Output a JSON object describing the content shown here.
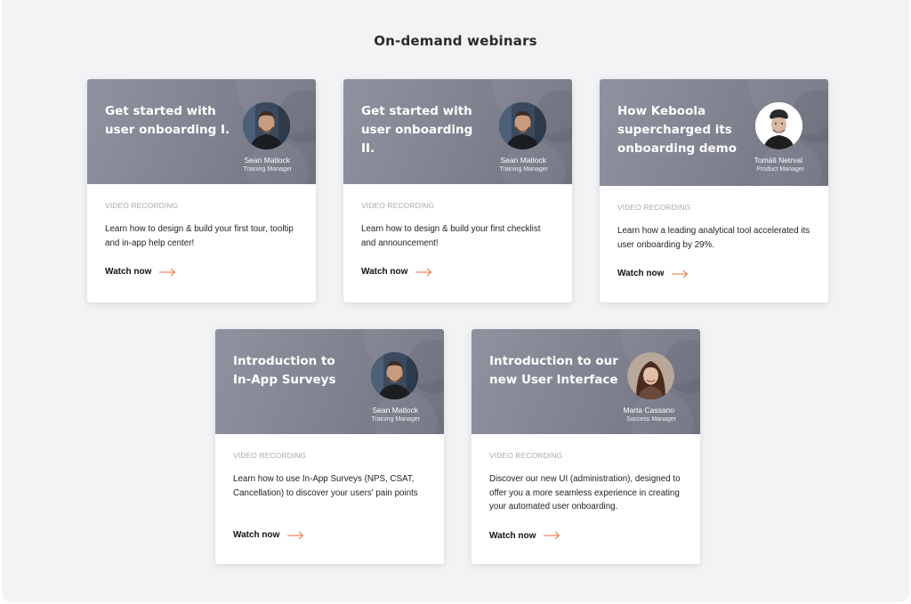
{
  "section": {
    "title": "On-demand webinars"
  },
  "colors": {
    "accent": "#f08a5d",
    "header_gradient_start": "#8f929f",
    "header_gradient_end": "#6f7280"
  },
  "cards": [
    {
      "title": "Get started with\nuser onboarding I.",
      "speaker": "Sean Matlock",
      "role": "Training Manager",
      "label": "VIDEO RECORDING",
      "description": "Learn how to design & build your first tour, tooltip and in-app help center!",
      "cta": "Watch now"
    },
    {
      "title": "Get started with\nuser onboarding II.",
      "speaker": "Sean Matlock",
      "role": "Training Manager",
      "label": "VIDEO RECORDING",
      "description": "Learn how to design & build your first checklist and announcement!",
      "cta": "Watch now"
    },
    {
      "title": "How Keboola\nsupercharged its\nonboarding demo",
      "speaker": "Tomáš Netrval",
      "role": "Product Manager",
      "label": "VIDEO RECORDING",
      "description": "Learn how a leading analytical tool accelerated its user onboarding by 29%.",
      "cta": "Watch now"
    },
    {
      "title": "Introduction to\nIn-App Surveys",
      "speaker": "Sean Matlock",
      "role": "Training Manager",
      "label": "VIDEO RECORDING",
      "description": "Learn how to use In-App Surveys (NPS, CSAT, Cancellation) to discover your users' pain points",
      "cta": "Watch now"
    },
    {
      "title": "Introduction to our\nnew User Interface",
      "speaker": "Marta Cassano",
      "role": "Success Manager",
      "label": "VIDEO RECORDING",
      "description": "Discover our new UI (administration), designed to offer you a more seamless experience in creating your automated user onboarding.",
      "cta": "Watch now"
    }
  ]
}
